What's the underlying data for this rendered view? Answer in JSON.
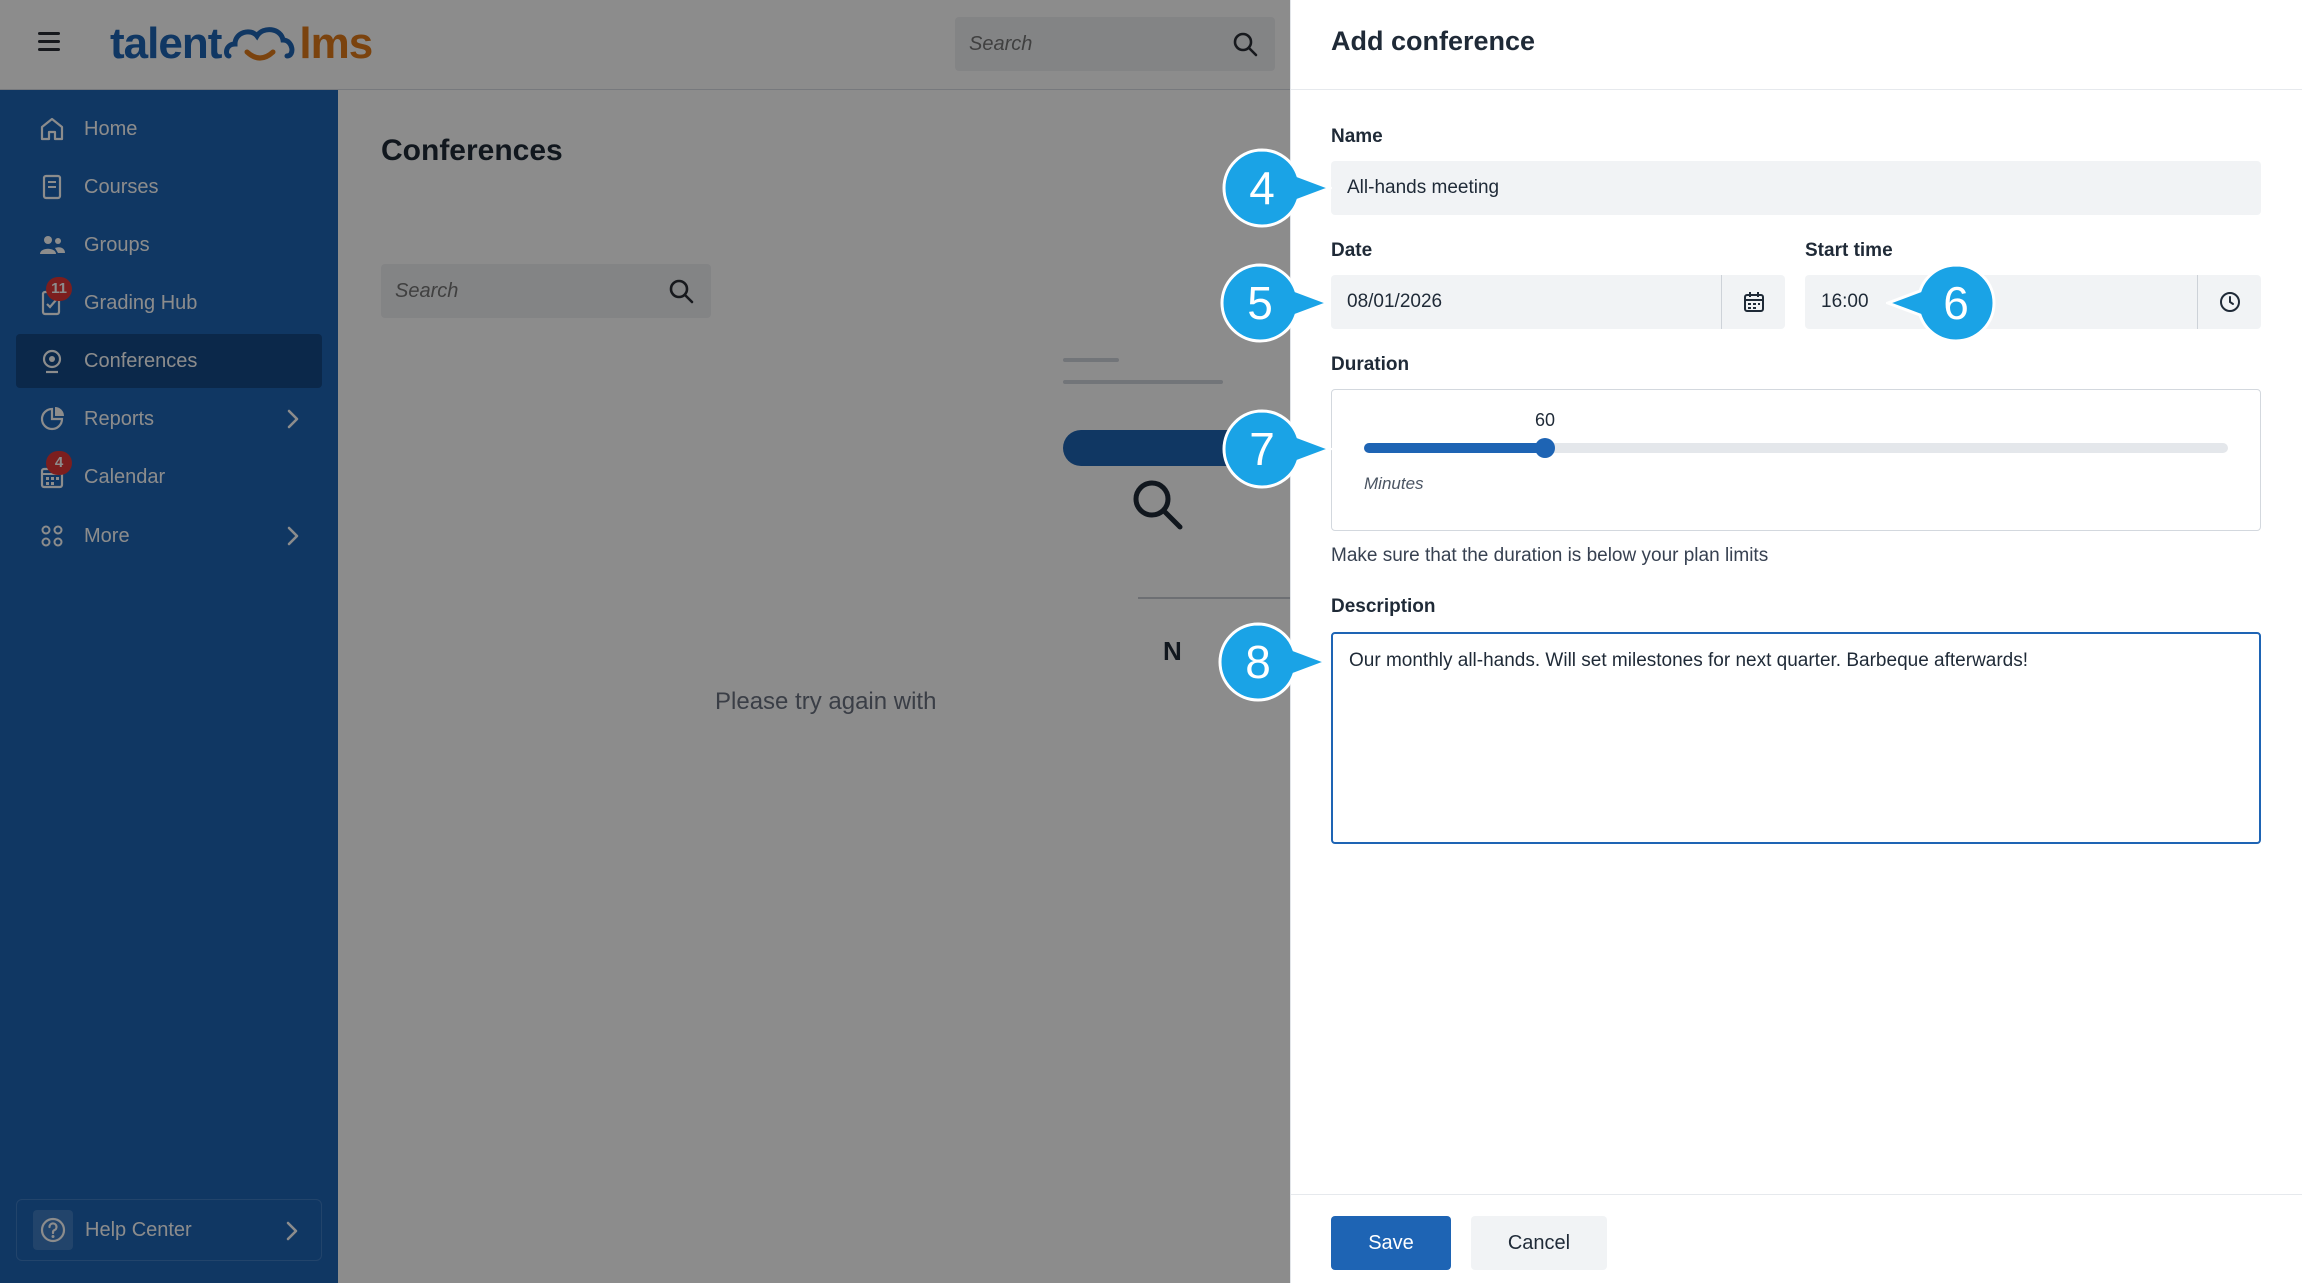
{
  "app": {
    "logo_left": "talent",
    "logo_right": "lms",
    "top_search_placeholder": "Search"
  },
  "sidebar": {
    "items": [
      {
        "label": "Home",
        "icon": "home-icon"
      },
      {
        "label": "Courses",
        "icon": "courses-icon"
      },
      {
        "label": "Groups",
        "icon": "groups-icon"
      },
      {
        "label": "Grading Hub",
        "icon": "grading-icon",
        "badge": "11"
      },
      {
        "label": "Conferences",
        "icon": "conference-icon",
        "active": true
      },
      {
        "label": "Reports",
        "icon": "reports-icon"
      },
      {
        "label": "Calendar",
        "icon": "calendar-icon",
        "badge": "4"
      },
      {
        "label": "More",
        "icon": "more-icon"
      }
    ],
    "help_label": "Help Center"
  },
  "content": {
    "title": "Conferences",
    "search_placeholder": "Search",
    "empty_heading_fragment": "N",
    "empty_message_fragment": "Please try again with"
  },
  "drawer": {
    "title": "Add conference",
    "name_label": "Name",
    "name_value": "All-hands meeting",
    "date_label": "Date",
    "date_value": "08/01/2026",
    "start_time_label": "Start time",
    "start_time_value": "16:00",
    "duration_label": "Duration",
    "duration_value": "60",
    "duration_fraction": 0.21,
    "duration_unit": "Minutes",
    "duration_hint": "Make sure that the duration is below your plan limits",
    "description_label": "Description",
    "description_value": "Our monthly all-hands. Will set milestones for next quarter. Barbeque afterwards!",
    "save_label": "Save",
    "cancel_label": "Cancel"
  },
  "callouts": [
    "4",
    "5",
    "6",
    "7",
    "8"
  ],
  "colors": {
    "brand_blue": "#1e64b4",
    "brand_orange": "#e07b1a",
    "callout_blue": "#1aa3e6",
    "badge_red": "#e23838"
  }
}
